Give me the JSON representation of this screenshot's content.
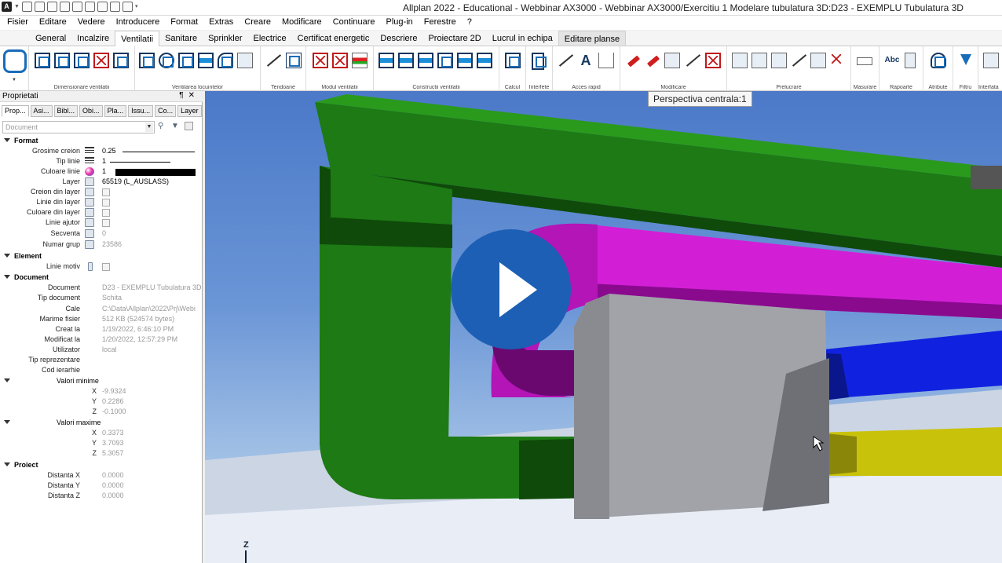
{
  "window": {
    "title": "Allplan 2022 - Educational - Webbinar AX3000 - Webbinar AX3000/Exercitiu 1 Modelare tubulatura 3D:D23 - EXEMPLU Tubulatura 3D",
    "app_logo": "A"
  },
  "menu": [
    "Fisier",
    "Editare",
    "Vedere",
    "Introducere",
    "Format",
    "Extras",
    "Creare",
    "Modificare",
    "Continuare",
    "Plug-in",
    "Ferestre",
    "?"
  ],
  "ribbon": {
    "tabs": [
      "General",
      "Incalzire",
      "Ventilatii",
      "Sanitare",
      "Sprinkler",
      "Electrice",
      "Certificat energetic",
      "Descriere",
      "Proiectare 2D",
      "Lucrul in echipa",
      "Editare planse"
    ],
    "active_tab": "Ventilatii",
    "groups": [
      "Dimensionare ventilatii",
      "Ventilarea locuintelor",
      "Tendoane",
      "Modul ventilatii",
      "Constructii ventilatii",
      "Calcul",
      "Interfete",
      "Acces rapid",
      "Modificare",
      "Prelucrare",
      "Masurare",
      "Rapoarte",
      "Atribute",
      "Filtru",
      "Interfata"
    ],
    "text_icon_A": "A",
    "text_icon_abc": "Abc"
  },
  "properties": {
    "title": "Proprietati",
    "tabs": [
      "Prop...",
      "Asi...",
      "Bibl...",
      "Obi...",
      "Pla...",
      "Issu...",
      "Co...",
      "Layer"
    ],
    "filter_value": "Document",
    "sections": {
      "format": "Format",
      "element": "Element",
      "document": "Document",
      "valori_minime": "Valori minime",
      "valori_maxime": "Valori maxime",
      "proiect": "Proiect"
    },
    "format_rows": [
      {
        "label": "Grosime creion",
        "value": "0.25"
      },
      {
        "label": "Tip linie",
        "value": "1"
      },
      {
        "label": "Culoare linie",
        "value": "1"
      },
      {
        "label": "Layer",
        "value": "65519 (L_AUSLASS)"
      },
      {
        "label": "Creion din layer",
        "value": ""
      },
      {
        "label": "Linie din layer",
        "value": ""
      },
      {
        "label": "Culoare din layer",
        "value": ""
      },
      {
        "label": "Linie ajutor",
        "value": ""
      },
      {
        "label": "Secventa",
        "value": "0"
      },
      {
        "label": "Numar grup",
        "value": "23586"
      }
    ],
    "element_rows": [
      {
        "label": "Linie motiv",
        "value": ""
      }
    ],
    "document_rows": [
      {
        "label": "Document",
        "value": "D23 - EXEMPLU Tubulatura 3D"
      },
      {
        "label": "Tip document",
        "value": "Schita"
      },
      {
        "label": "Cale",
        "value": "C:\\Data\\Allplan\\2022\\Prj\\Webi"
      },
      {
        "label": "Marime fisier",
        "value": "512 KB (524574 bytes)"
      },
      {
        "label": "Creat la",
        "value": "1/19/2022, 6:46:10 PM"
      },
      {
        "label": "Modificat la",
        "value": "1/20/2022, 12:57:29 PM"
      },
      {
        "label": "Utilizator",
        "value": "local"
      },
      {
        "label": "Tip reprezentare",
        "value": ""
      },
      {
        "label": "Cod ierarhie",
        "value": ""
      }
    ],
    "min_rows": [
      {
        "label": "X",
        "value": "-9.9324"
      },
      {
        "label": "Y",
        "value": "0.2286"
      },
      {
        "label": "Z",
        "value": "-0.1000"
      }
    ],
    "max_rows": [
      {
        "label": "X",
        "value": "0.3373"
      },
      {
        "label": "Y",
        "value": "3.7093"
      },
      {
        "label": "Z",
        "value": "5.3057"
      }
    ],
    "proiect_rows": [
      {
        "label": "Distanta X",
        "value": "0.0000"
      },
      {
        "label": "Distanta Y",
        "value": "0.0000"
      },
      {
        "label": "Distanta Z",
        "value": "0.0000"
      }
    ]
  },
  "viewport": {
    "tooltip": "Perspectiva centrala:1",
    "axis_label": "Z",
    "colors": {
      "green": "#1d7a14",
      "magenta": "#d21fd6",
      "blue": "#1022e0",
      "yellow": "#c9c20a",
      "gray": "#a2a3a9",
      "play": "#1c5fb5"
    }
  }
}
